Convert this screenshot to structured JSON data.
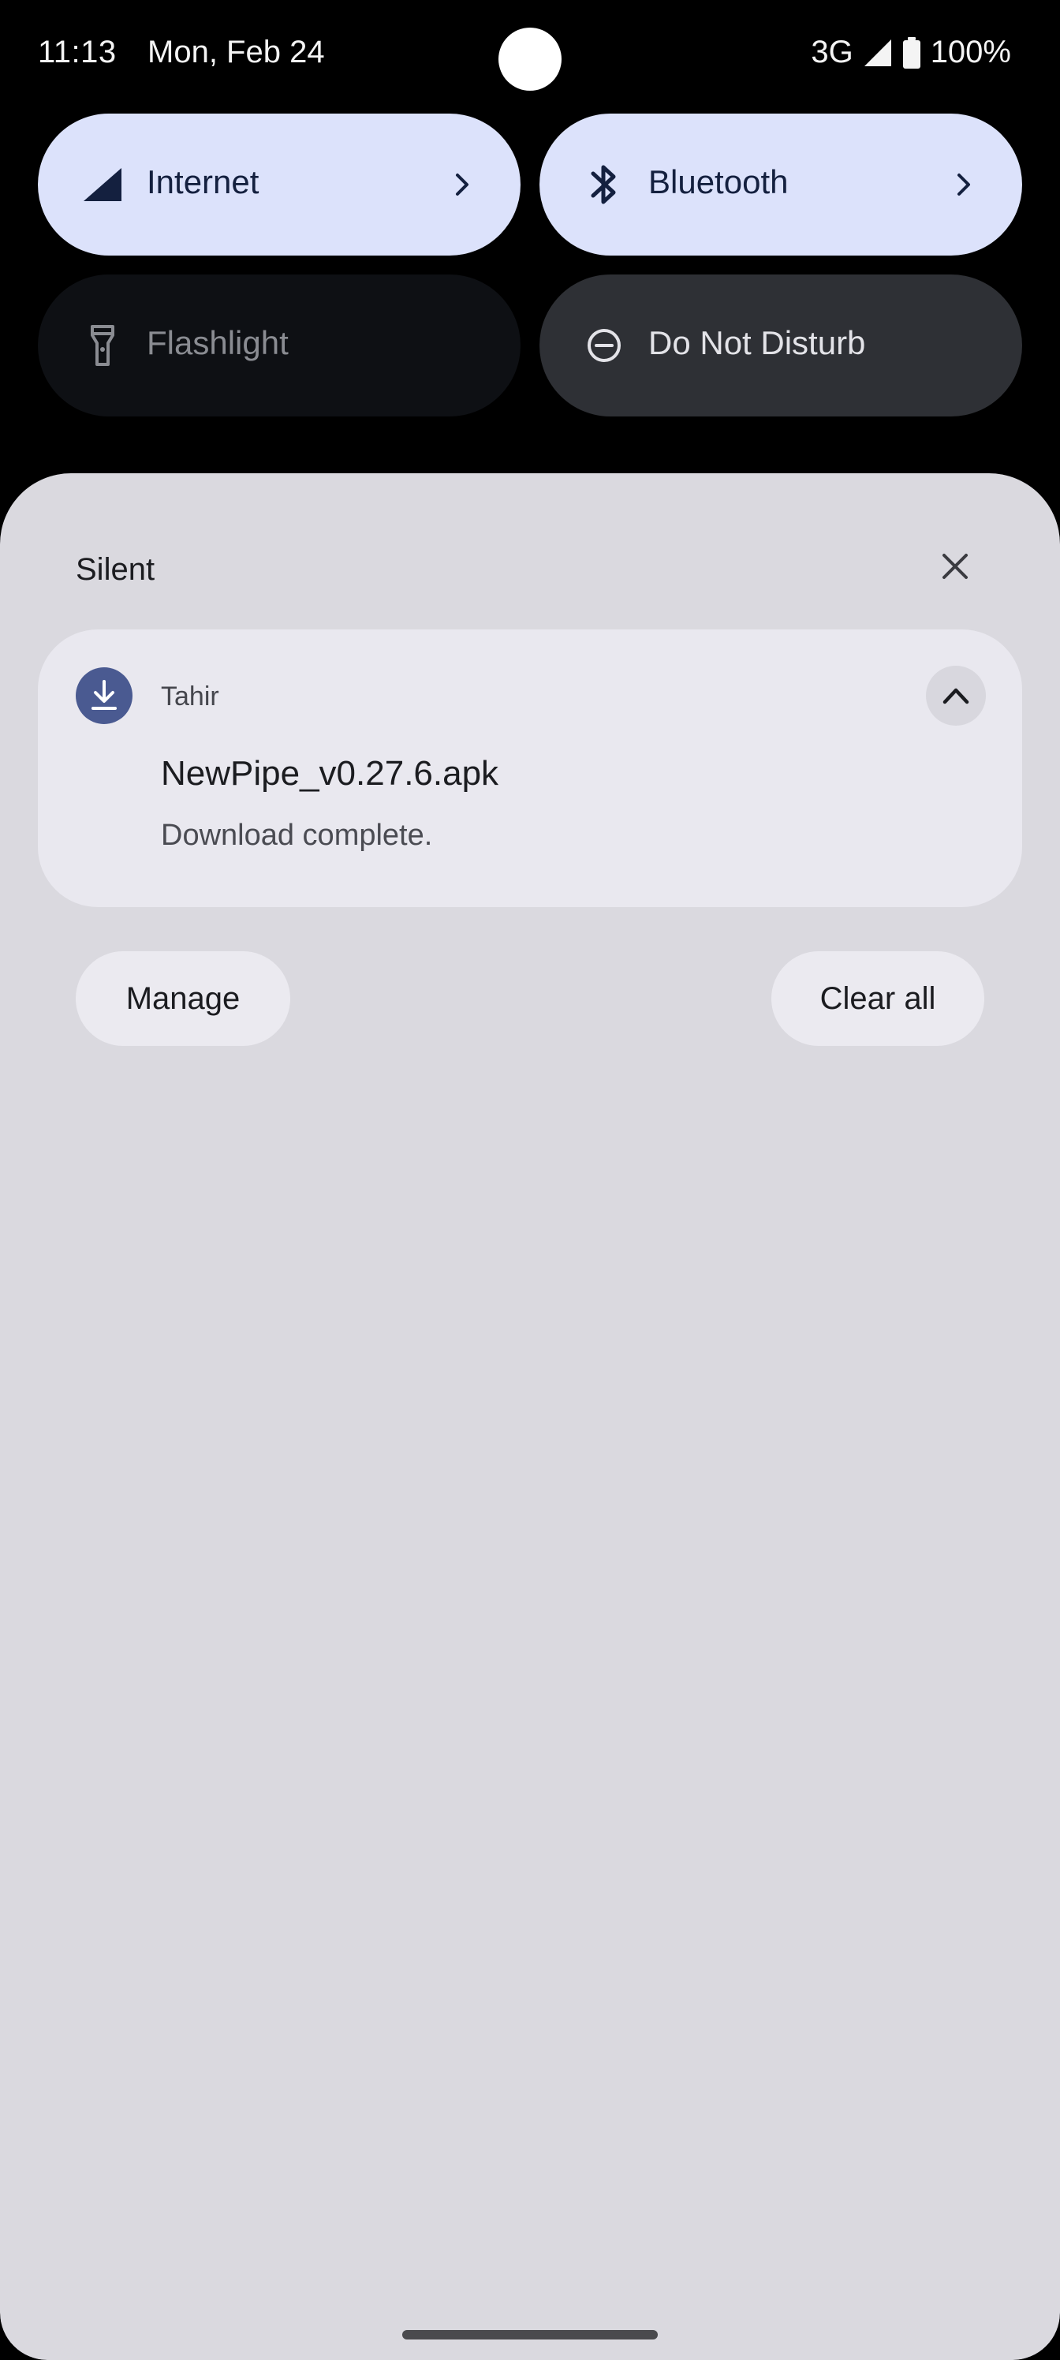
{
  "status_bar": {
    "time": "11:13",
    "date": "Mon, Feb 24",
    "network": "3G",
    "battery": "100%",
    "icons": [
      "signal-icon",
      "battery-icon"
    ]
  },
  "quick_settings": {
    "tiles": [
      {
        "label": "Internet",
        "state": "on",
        "icon": "signal-icon",
        "has_chevron": true
      },
      {
        "label": "Bluetooth",
        "state": "on",
        "icon": "bluetooth-icon",
        "has_chevron": true
      },
      {
        "label": "Flashlight",
        "state": "unavailable",
        "icon": "flashlight-icon"
      },
      {
        "label": "Do Not Disturb",
        "state": "off",
        "icon": "dnd-icon"
      }
    ]
  },
  "notifications": {
    "section_label": "Silent",
    "items": [
      {
        "app": "Tahir",
        "title": "NewPipe_v0.27.6.apk",
        "text": "Download complete.",
        "icon": "download-icon"
      }
    ],
    "manage_label": "Manage",
    "clear_all_label": "Clear all"
  },
  "colors": {
    "tile_on": "#dce2fb",
    "tile_off": "#2e3035",
    "sheet": "#dad9df",
    "app_icon": "#4a5a91"
  }
}
